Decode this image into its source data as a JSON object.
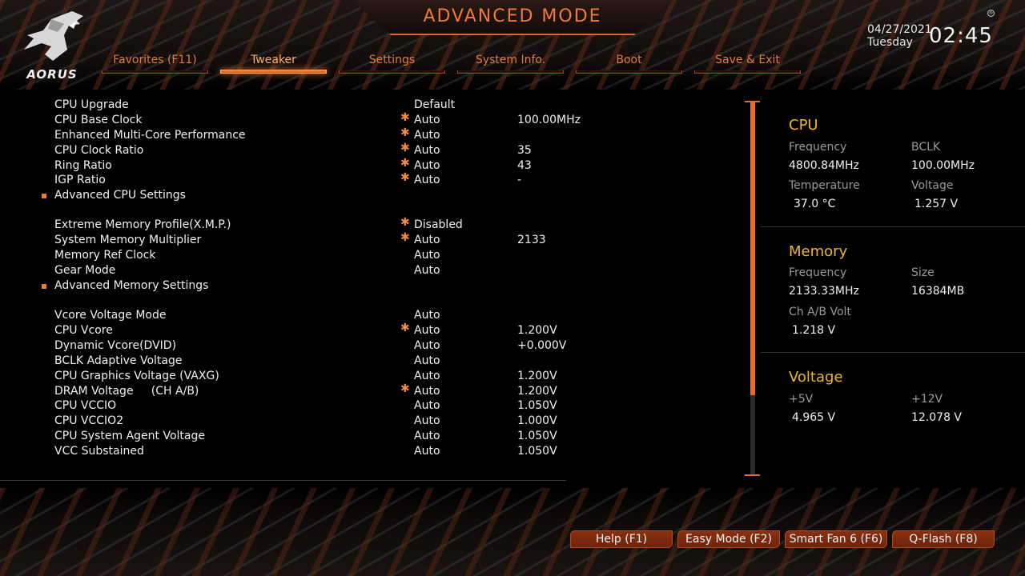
{
  "app": {
    "title": "ADVANCED MODE",
    "logo_text": "AORUS",
    "logo_icon": "aorus-eagle-icon"
  },
  "clock": {
    "date": "04/27/2021",
    "day": "Tuesday",
    "time": "02:45"
  },
  "tabs": [
    {
      "label": "Favorites (F11)",
      "active": false
    },
    {
      "label": "Tweaker",
      "active": true
    },
    {
      "label": "Settings",
      "active": false
    },
    {
      "label": "System Info.",
      "active": false
    },
    {
      "label": "Boot",
      "active": false
    },
    {
      "label": "Save & Exit",
      "active": false
    }
  ],
  "settings": [
    {
      "label": "CPU Upgrade",
      "star": false,
      "submenu": false,
      "value": "Default",
      "reading": ""
    },
    {
      "label": "CPU Base Clock",
      "star": true,
      "submenu": false,
      "value": "Auto",
      "reading": "100.00MHz"
    },
    {
      "label": "Enhanced Multi-Core Performance",
      "star": true,
      "submenu": false,
      "value": "Auto",
      "reading": ""
    },
    {
      "label": "CPU Clock Ratio",
      "star": true,
      "submenu": false,
      "value": "Auto",
      "reading": "35"
    },
    {
      "label": "Ring Ratio",
      "star": true,
      "submenu": false,
      "value": "Auto",
      "reading": "43"
    },
    {
      "label": "IGP Ratio",
      "star": true,
      "submenu": false,
      "value": "Auto",
      "reading": "-"
    },
    {
      "label": "Advanced CPU Settings",
      "star": false,
      "submenu": true,
      "value": "",
      "reading": ""
    },
    {
      "label": "Extreme Memory Profile(X.M.P.)",
      "star": true,
      "submenu": false,
      "value": "Disabled",
      "reading": ""
    },
    {
      "label": "System Memory Multiplier",
      "star": true,
      "submenu": false,
      "value": "Auto",
      "reading": "2133"
    },
    {
      "label": "Memory Ref Clock",
      "star": false,
      "submenu": false,
      "value": "Auto",
      "reading": ""
    },
    {
      "label": "Gear Mode",
      "star": false,
      "submenu": false,
      "value": "Auto",
      "reading": ""
    },
    {
      "label": "Advanced Memory Settings",
      "star": false,
      "submenu": true,
      "value": "",
      "reading": ""
    },
    {
      "label": "Vcore Voltage Mode",
      "star": false,
      "submenu": false,
      "value": "Auto",
      "reading": ""
    },
    {
      "label": "CPU Vcore",
      "star": true,
      "submenu": false,
      "value": "Auto",
      "reading": "1.200V"
    },
    {
      "label": "Dynamic Vcore(DVID)",
      "star": false,
      "submenu": false,
      "value": "Auto",
      "reading": "+0.000V"
    },
    {
      "label": "BCLK Adaptive Voltage",
      "star": false,
      "submenu": false,
      "value": "Auto",
      "reading": ""
    },
    {
      "label": "CPU Graphics Voltage (VAXG)",
      "star": false,
      "submenu": false,
      "value": "Auto",
      "reading": "1.200V"
    },
    {
      "label": "DRAM Voltage     (CH A/B)",
      "star": true,
      "submenu": false,
      "value": "Auto",
      "reading": "1.200V"
    },
    {
      "label": "CPU VCCIO",
      "star": false,
      "submenu": false,
      "value": "Auto",
      "reading": "1.050V"
    },
    {
      "label": "CPU VCCIO2",
      "star": false,
      "submenu": false,
      "value": "Auto",
      "reading": "1.000V"
    },
    {
      "label": "CPU System Agent Voltage",
      "star": false,
      "submenu": false,
      "value": "Auto",
      "reading": "1.050V"
    },
    {
      "label": "VCC Substained",
      "star": false,
      "submenu": false,
      "value": "Auto",
      "reading": "1.050V"
    }
  ],
  "scroll": {
    "visible_fraction": 0.785
  },
  "info": {
    "cpu": {
      "title": "CPU",
      "frequency_label": "Frequency",
      "frequency": "4800.84MHz",
      "bclk_label": "BCLK",
      "bclk": "100.00MHz",
      "temperature_label": "Temperature",
      "temperature": "37.0 °C",
      "voltage_label": "Voltage",
      "voltage": "1.257 V"
    },
    "memory": {
      "title": "Memory",
      "frequency_label": "Frequency",
      "frequency": "2133.33MHz",
      "size_label": "Size",
      "size": "16384MB",
      "volt_label": "Ch A/B Volt",
      "volt": "1.218 V"
    },
    "voltage": {
      "title": "Voltage",
      "v5_label": "+5V",
      "v5": "4.965 V",
      "v12_label": "+12V",
      "v12": "12.078 V"
    }
  },
  "buttons": {
    "help": "Help (F1)",
    "easy_mode": "Easy Mode (F2)",
    "smart_fan": "Smart Fan 6 (F6)",
    "qflash": "Q-Flash (F8)"
  },
  "colors": {
    "accent": "#e86a24",
    "heading": "#f0b429",
    "tab": "#e27a3a"
  }
}
